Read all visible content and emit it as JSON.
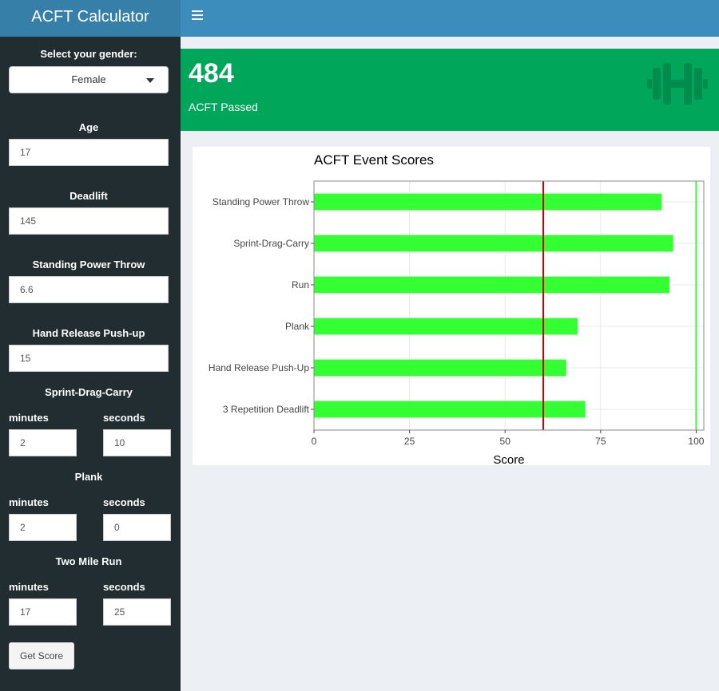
{
  "app": {
    "title": "ACFT Calculator"
  },
  "sidebar": {
    "gender": {
      "label": "Select your gender:",
      "value": "Female"
    },
    "age": {
      "label": "Age",
      "value": "17"
    },
    "deadlift": {
      "label": "Deadlift",
      "value": "145"
    },
    "power_throw": {
      "label": "Standing Power Throw",
      "value": "6.6"
    },
    "pushup": {
      "label": "Hand Release Push-up",
      "value": "15"
    },
    "sdc": {
      "label": "Sprint-Drag-Carry",
      "min_label": "minutes",
      "sec_label": "seconds",
      "minutes": "2",
      "seconds": "10"
    },
    "plank": {
      "label": "Plank",
      "min_label": "minutes",
      "sec_label": "seconds",
      "minutes": "2",
      "seconds": "0"
    },
    "run": {
      "label": "Two Mile Run",
      "min_label": "minutes",
      "sec_label": "seconds",
      "minutes": "17",
      "seconds": "25"
    },
    "submit_label": "Get Score"
  },
  "valuebox": {
    "value": "484",
    "subtitle": "ACFT Passed",
    "color": "#00a65a",
    "icon": "dumbbell-icon"
  },
  "chart_data": {
    "type": "bar",
    "orientation": "horizontal",
    "title": "ACFT Event Scores",
    "xlabel": "Score",
    "ylabel": "",
    "categories": [
      "3 Repetition Deadlift",
      "Hand Release Push-Up",
      "Plank",
      "Run",
      "Sprint-Drag-Carry",
      "Standing Power Throw"
    ],
    "values": [
      71,
      66,
      69,
      93,
      94,
      91
    ],
    "xlim": [
      0,
      102
    ],
    "xticks": [
      0,
      25,
      50,
      75,
      100
    ],
    "reference_lines": [
      {
        "x": 60,
        "color": "#cc0000"
      },
      {
        "x": 100,
        "color": "#33ff33"
      }
    ],
    "bar_color": "#33ff33",
    "grid": true
  }
}
